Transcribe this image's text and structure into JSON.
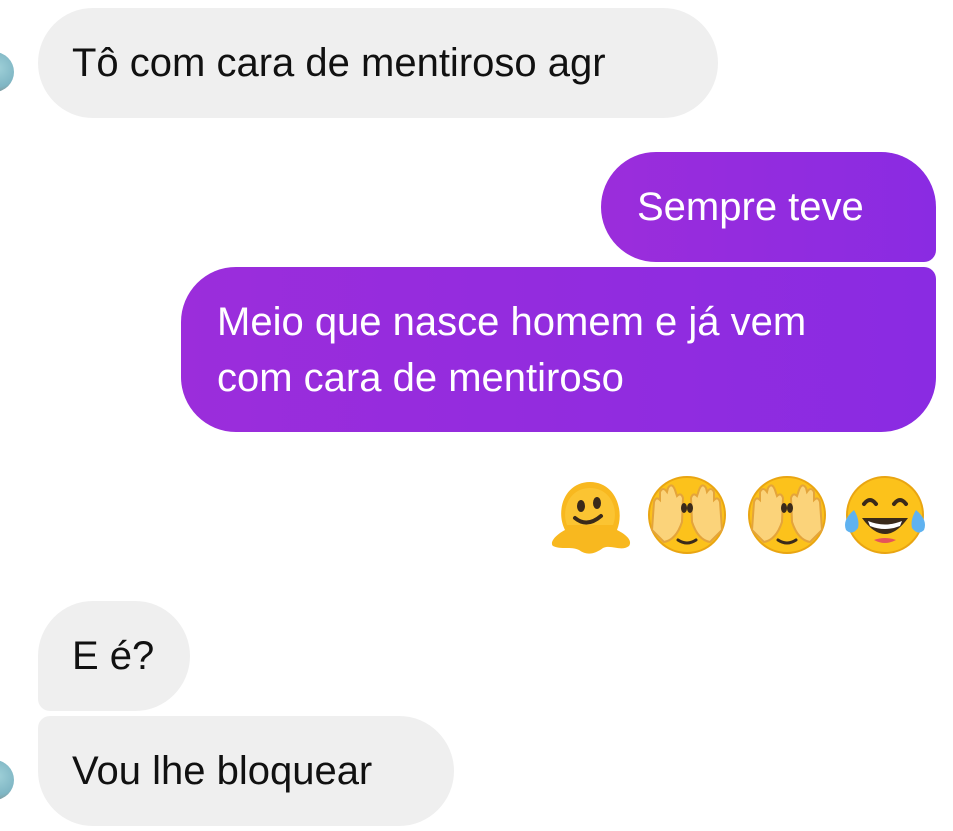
{
  "messages": [
    {
      "id": "m1",
      "side": "received",
      "text": "Tô com cara de mentiroso agr"
    },
    {
      "id": "m2",
      "side": "sent",
      "text": "Sempre teve"
    },
    {
      "id": "m3",
      "side": "sent",
      "line1": "Meio que nasce homem e já vem",
      "line2": "com cara de mentiroso"
    },
    {
      "id": "m4",
      "side": "sent",
      "emojis": [
        "melting-face-icon",
        "face-with-hands-over-eyes-icon",
        "face-with-hands-over-eyes-icon",
        "face-with-tears-of-joy-icon"
      ]
    },
    {
      "id": "m5",
      "side": "received",
      "text": "E é?"
    },
    {
      "id": "m6",
      "side": "received",
      "text": "Vou lhe bloquear"
    }
  ],
  "colors": {
    "sent_bubble": "#8a2be2",
    "received_bubble": "#efefef",
    "emoji_yellow": "#fcc21b"
  }
}
